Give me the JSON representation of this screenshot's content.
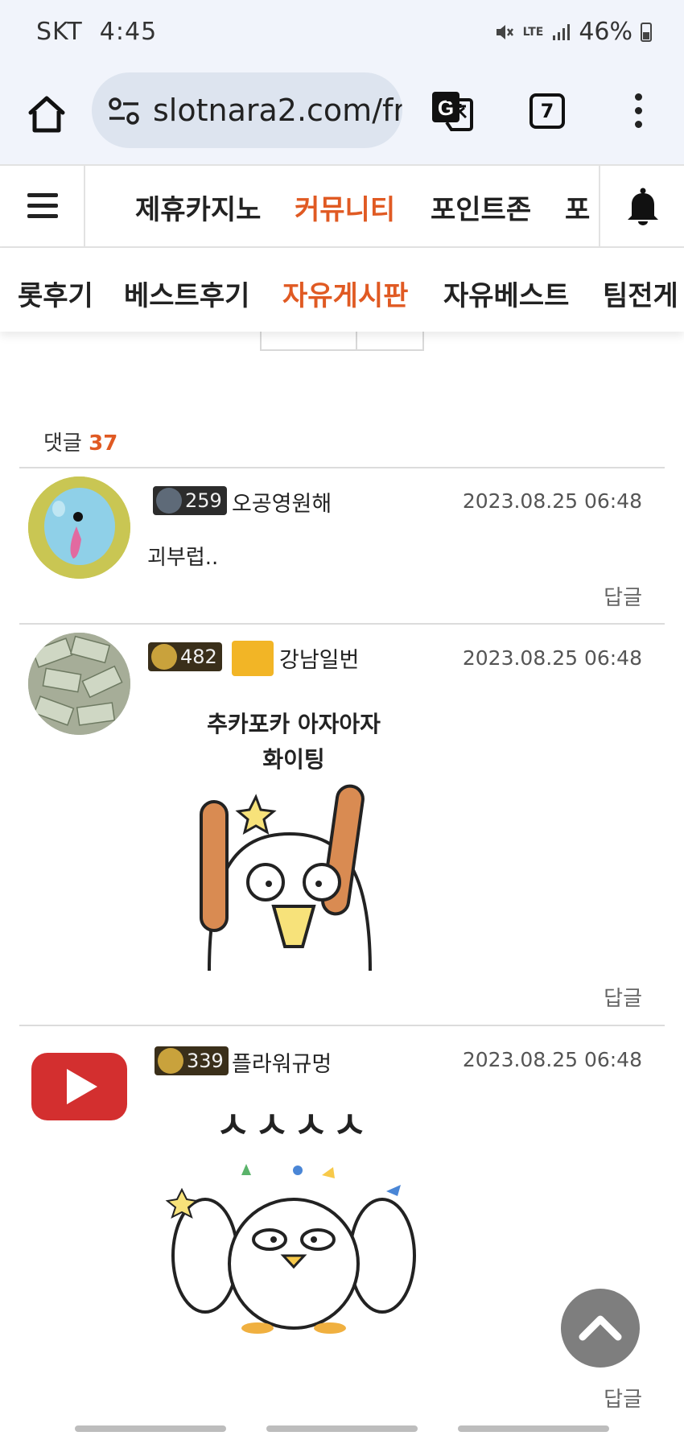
{
  "status_bar": {
    "carrier": "SKT",
    "time": "4:45",
    "network": "LTE",
    "battery": "46%"
  },
  "browser": {
    "url": "slotnara2.com/fr",
    "tab_count": "7"
  },
  "nav": {
    "items": [
      "제휴카지노",
      "커뮤니티",
      "포인트존",
      "포"
    ],
    "active": "커뮤니티"
  },
  "subnav": {
    "items": [
      "롯후기",
      "베스트후기",
      "자유게시판",
      "자유베스트",
      "팀전게"
    ],
    "active": "자유게시판"
  },
  "comments": {
    "label": "댓글",
    "count": "37",
    "items": [
      {
        "level": "259",
        "nickname": "오공영원해",
        "date": "2023.08.25 06:48",
        "text": "괴부럽..",
        "reply": "답글",
        "avatar": "blue-cartoon-creature"
      },
      {
        "level": "482",
        "nickname": "강남일번",
        "date": "2023.08.25 06:48",
        "sticker_text": [
          "추카포카 아자아자",
          "화이팅"
        ],
        "reply": "답글",
        "avatar": "money-pile"
      },
      {
        "level": "339",
        "nickname": "플라워규멍",
        "date": "2023.08.25 06:48",
        "sticker_text": [
          "ㅅㅅㅅㅅ"
        ],
        "reply": "답글",
        "avatar": "youtube-logo"
      }
    ]
  },
  "colors": {
    "accent": "#e05a23",
    "status_bg": "#f1f4fb",
    "url_bg": "#dde4ef"
  }
}
